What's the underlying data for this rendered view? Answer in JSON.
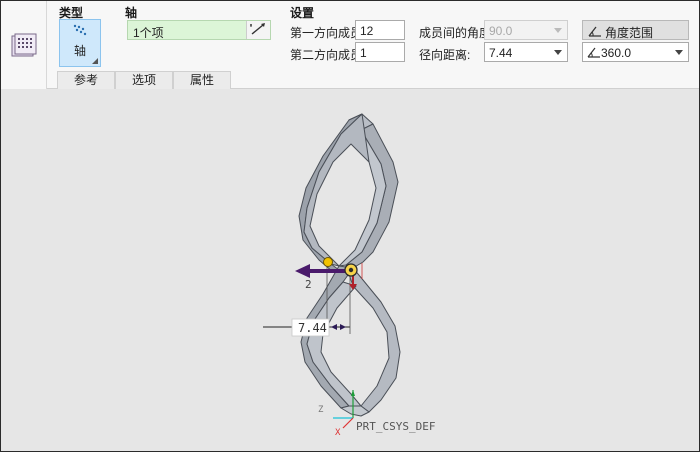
{
  "ribbon": {
    "type_group": {
      "title": "类型",
      "tile_label": "轴"
    },
    "axis_group": {
      "title": "轴",
      "collector_text": "1个项"
    },
    "settings_group": {
      "title": "设置",
      "first_dir_label": "第一方向成员:",
      "first_dir_value": "12",
      "second_dir_label": "第二方向成员:",
      "second_dir_value": "1",
      "angle_between_label": "成员间的角度:",
      "angle_between_value": "90.0",
      "radial_dist_label": "径向距离:",
      "radial_dist_value": "7.44",
      "angle_range_label": "角度范围",
      "angle_range_value": "360.0"
    },
    "tabs": [
      "参考",
      "选项",
      "属性"
    ]
  },
  "canvas": {
    "dimension_value": "7.44",
    "direction_count_label": "2",
    "csys_label": "PRT_CSYS_DEF",
    "csys_x": "X",
    "csys_z": "Z"
  },
  "colors": {
    "accent_tile": "#cfe8fb",
    "collector_green": "#dcf5d7",
    "model_fill": "#a7adb6",
    "arrow_purple": "#4a1a6b",
    "handle_yellow": "#f2c200"
  },
  "icons": [
    "pattern-feature-icon",
    "axis-pattern-icon",
    "flip-direction-icon",
    "angle-range-icon",
    "dropdown-caret-icon"
  ]
}
